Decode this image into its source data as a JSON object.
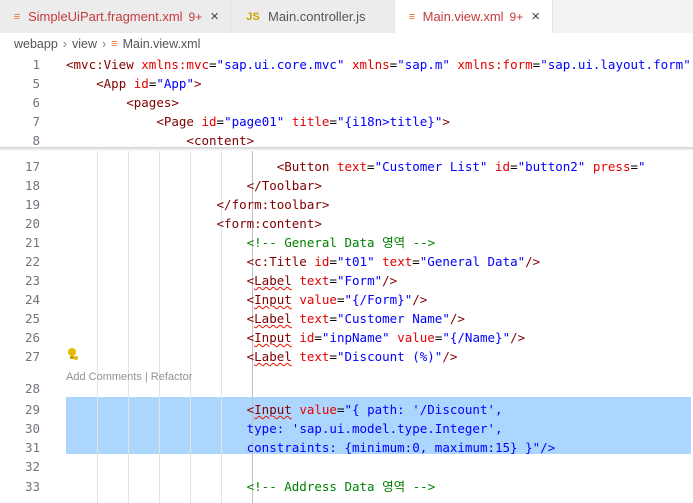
{
  "tabs": [
    {
      "name": "SimpleUiPart.fragment.xml",
      "badge": "9+",
      "icon": "rss-icon",
      "active": false,
      "close": "×"
    },
    {
      "name": "Main.controller.js",
      "badge": "",
      "icon": "js-icon",
      "active": false,
      "close": ""
    },
    {
      "name": "Main.view.xml",
      "badge": "9+",
      "icon": "rss-icon",
      "active": true,
      "close": "×"
    }
  ],
  "tab_icon_glyphs": {
    "xml": "≡",
    "js": "JS"
  },
  "breadcrumb": {
    "parts": [
      "webapp",
      "view"
    ],
    "file": "Main.view.xml",
    "separator": "›"
  },
  "colors": {
    "tag": "#800000",
    "attribute": "#e50000",
    "value": "#0000ff",
    "comment": "#008000",
    "selection": "#add6ff"
  },
  "codelens": {
    "add_comments": "Add Comments",
    "divider": " | ",
    "refactor": "Refactor"
  },
  "lines": [
    {
      "num": "1",
      "text": "<mvc:View xmlns:mvc=\"sap.ui.core.mvc\" xmlns=\"sap.m\" xmlns:form=\"sap.ui.layout.form\""
    },
    {
      "num": "5",
      "text": "    <App id=\"App\">"
    },
    {
      "num": "6",
      "text": "        <pages>"
    },
    {
      "num": "7",
      "text": "            <Page id=\"page01\" title=\"{i18n>title}\">"
    },
    {
      "num": "8",
      "text": "                <content>"
    },
    {
      "num": "17",
      "text": "                            <Button text=\"Customer List\" id=\"button2\" press=\""
    },
    {
      "num": "18",
      "text": "                        </Toolbar>"
    },
    {
      "num": "19",
      "text": "                    </form:toolbar>"
    },
    {
      "num": "20",
      "text": "                    <form:content>"
    },
    {
      "num": "21",
      "text": "                        <!-- General Data 영역 -->"
    },
    {
      "num": "22",
      "text": "                        <c:Title id=\"t01\" text=\"General Data\"/>"
    },
    {
      "num": "23",
      "text": "                        <Label text=\"Form\"/>"
    },
    {
      "num": "24",
      "text": "                        <Input value=\"{/Form}\"/>"
    },
    {
      "num": "25",
      "text": "                        <Label text=\"Customer Name\"/>"
    },
    {
      "num": "26",
      "text": "                        <Input id=\"inpName\" value=\"{/Name}\"/>"
    },
    {
      "num": "27",
      "text": "                        <Label text=\"Discount (%)\"/>"
    },
    {
      "num": "28",
      "text": ""
    },
    {
      "num": "29",
      "text": "                        <Input value=\"{ path: '/Discount',"
    },
    {
      "num": "30",
      "text": "                        type: 'sap.ui.model.type.Integer',"
    },
    {
      "num": "31",
      "text": "                        constraints: {minimum:0, maximum:15} }\"/>"
    },
    {
      "num": "32",
      "text": ""
    },
    {
      "num": "33",
      "text": "                        <!-- Address Data 영역 -->"
    }
  ]
}
